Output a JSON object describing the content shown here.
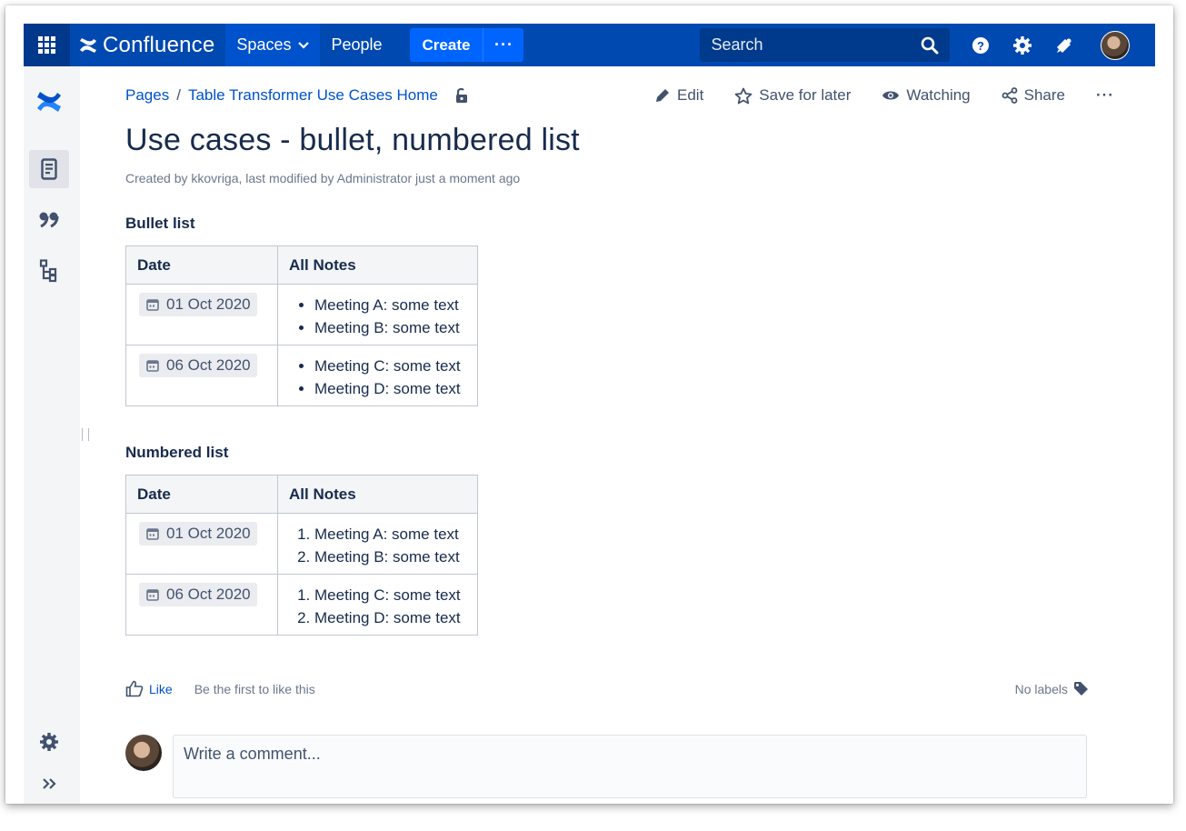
{
  "topnav": {
    "logo_text": "Confluence",
    "spaces_label": "Spaces",
    "people_label": "People",
    "create_label": "Create",
    "more_label": "···",
    "search_placeholder": "Search"
  },
  "breadcrumb": {
    "pages": "Pages",
    "separator": "/",
    "parent": "Table Transformer Use Cases Home"
  },
  "actions": {
    "edit": "Edit",
    "save_for_later": "Save for later",
    "watching": "Watching",
    "share": "Share",
    "more": "···"
  },
  "page": {
    "title": "Use cases - bullet, numbered list",
    "byline": "Created by kkovriga, last modified by Administrator just a moment ago"
  },
  "bullet_section": {
    "heading": "Bullet list",
    "headers": [
      "Date",
      "All Notes"
    ],
    "rows": [
      {
        "date": "01 Oct 2020",
        "notes": [
          "Meeting A: some text",
          "Meeting B: some text"
        ]
      },
      {
        "date": "06 Oct 2020",
        "notes": [
          "Meeting C: some text",
          "Meeting D: some text"
        ]
      }
    ]
  },
  "numbered_section": {
    "heading": "Numbered list",
    "headers": [
      "Date",
      "All Notes"
    ],
    "rows": [
      {
        "date": "01 Oct 2020",
        "notes": [
          "Meeting A: some text",
          "Meeting B: some text"
        ]
      },
      {
        "date": "06 Oct 2020",
        "notes": [
          "Meeting C: some text",
          "Meeting D: some text"
        ]
      }
    ]
  },
  "footer": {
    "like": "Like",
    "first_like": "Be the first to like this",
    "no_labels": "No labels",
    "comment_placeholder": "Write a comment..."
  },
  "colors": {
    "nav_bg": "#0049b0",
    "create_bg": "#0065ff",
    "link": "#0052cc",
    "text": "#172b4d"
  }
}
